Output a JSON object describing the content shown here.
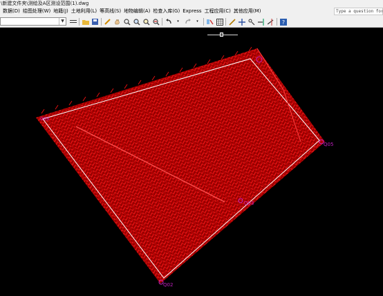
{
  "title": {
    "path": "\\新建文件夹\\测绘及A区测设范围(1).dwg"
  },
  "menu": [
    {
      "label": "数据(D)"
    },
    {
      "label": "绘图处理(W)"
    },
    {
      "label": "地籍(J)"
    },
    {
      "label": "土地利用(L)"
    },
    {
      "label": "等高线(S)"
    },
    {
      "label": "地物编辑(A)"
    },
    {
      "label": "检查入库(G)"
    },
    {
      "label": "Express"
    },
    {
      "label": "工程应用(C)"
    },
    {
      "label": "其他应用(M)"
    }
  ],
  "help": {
    "placeholder": "Type a question for"
  },
  "layer": {
    "value": ""
  },
  "drawing": {
    "boundary_color": "#ffffff",
    "fill_color": "#c40000",
    "label_color": "#c020c0",
    "labels": [
      {
        "text": "003"
      },
      {
        "text": "Q05"
      },
      {
        "text": "Q03"
      },
      {
        "text": "Q02"
      }
    ]
  }
}
